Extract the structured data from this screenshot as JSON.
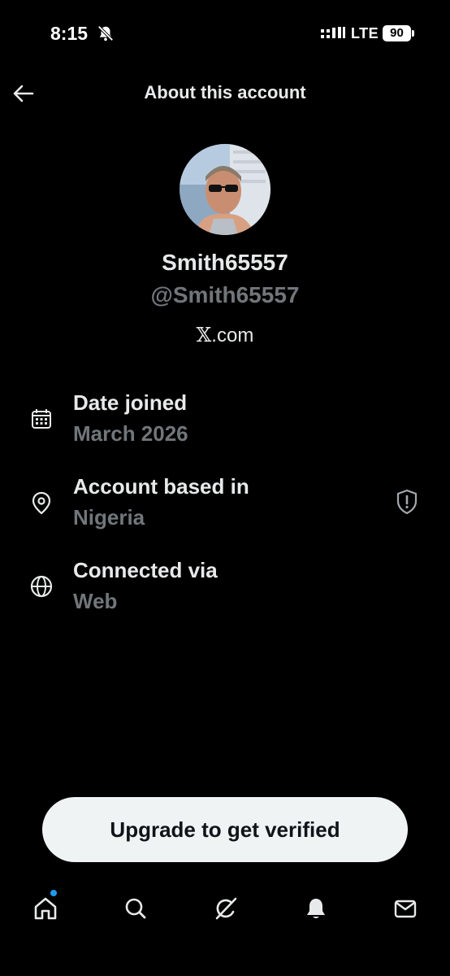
{
  "status_bar": {
    "time": "8:15",
    "network": "LTE",
    "battery": "90"
  },
  "header": {
    "title": "About this account",
    "back_icon": "arrow-left-icon"
  },
  "profile": {
    "display_name": "Smith65557",
    "handle": "@Smith65557",
    "platform_x": "𝕏",
    "platform_suffix": ".com"
  },
  "info": [
    {
      "icon": "calendar-icon",
      "label": "Date joined",
      "value": "March 2026"
    },
    {
      "icon": "location-pin-icon",
      "label": "Account based in",
      "value": "Nigeria"
    },
    {
      "icon": "globe-icon",
      "label": "Connected via",
      "value": "Web"
    }
  ],
  "upgrade_button": "Upgrade to get verified",
  "nav": [
    "home-icon",
    "search-icon",
    "grok-icon",
    "notifications-icon",
    "messages-icon"
  ],
  "colors": {
    "background": "#000000",
    "primary_text": "#e7e9ea",
    "secondary_text": "#71767b",
    "button_bg": "#eff3f4",
    "accent": "#1d9bf0"
  }
}
